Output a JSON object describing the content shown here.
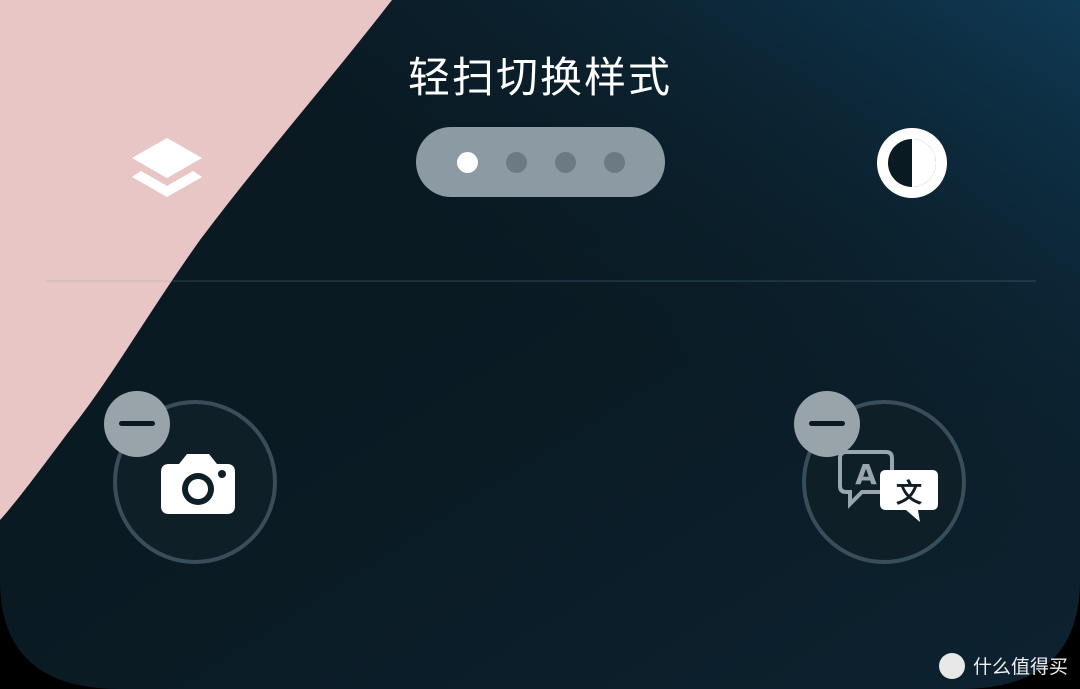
{
  "header": {
    "title": "轻扫切换样式"
  },
  "pager": {
    "page_count": 4,
    "active_index": 0
  },
  "toolbar": {
    "left_icon": "layers-icon",
    "right_icon": "contrast-icon"
  },
  "shortcuts": [
    {
      "icon": "camera-icon",
      "badge_icon": "remove-icon"
    },
    {
      "icon": "translate-icon",
      "badge_icon": "remove-icon",
      "glyph_a": "A",
      "glyph_wen": "文"
    }
  ],
  "watermark": {
    "text": "什么值得买"
  },
  "colors": {
    "wallpaper_pink": "#e9c6c6",
    "wallpaper_dark": "#0b1c25",
    "pager_bg": "#8b9aa3",
    "badge": "#98a3aa"
  }
}
